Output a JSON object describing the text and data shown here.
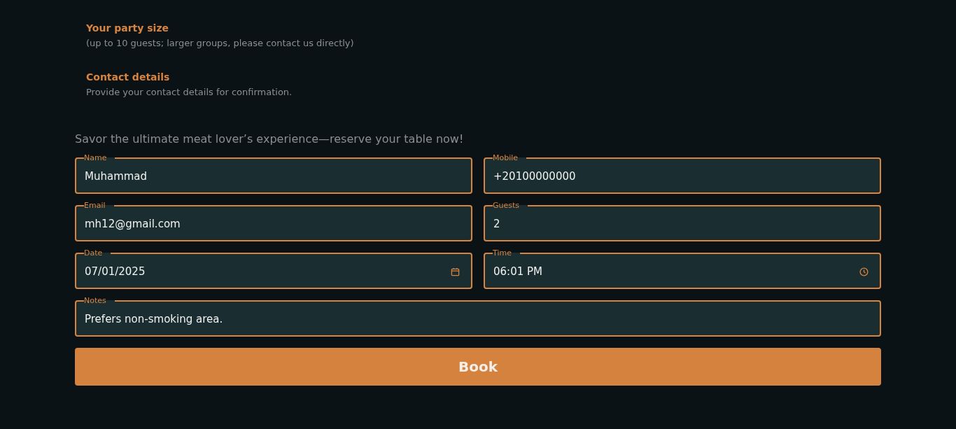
{
  "info": [
    {
      "title": "Your party size",
      "text": "(up to 10 guests; larger groups, please contact us directly)"
    },
    {
      "title": "Contact details",
      "text": "Provide your contact details for confirmation."
    }
  ],
  "tagline": "Savor the ultimate meat lover’s experience—reserve your table now!",
  "fields": [
    {
      "kind": "text",
      "label": "Name",
      "value": "Muhammad"
    },
    {
      "kind": "text",
      "label": "Mobile",
      "value": "+20100000000"
    },
    {
      "kind": "text",
      "label": "Email",
      "value": "mh12@gmail.com"
    },
    {
      "kind": "text",
      "label": "Guests",
      "value": "2"
    },
    {
      "kind": "date",
      "label": "Date",
      "value": "07/01/2025"
    },
    {
      "kind": "time",
      "label": "Time",
      "value": "06:01 PM"
    },
    {
      "kind": "notes",
      "label": "Notes",
      "value": "Prefers non-smoking area."
    }
  ],
  "button": "Book"
}
